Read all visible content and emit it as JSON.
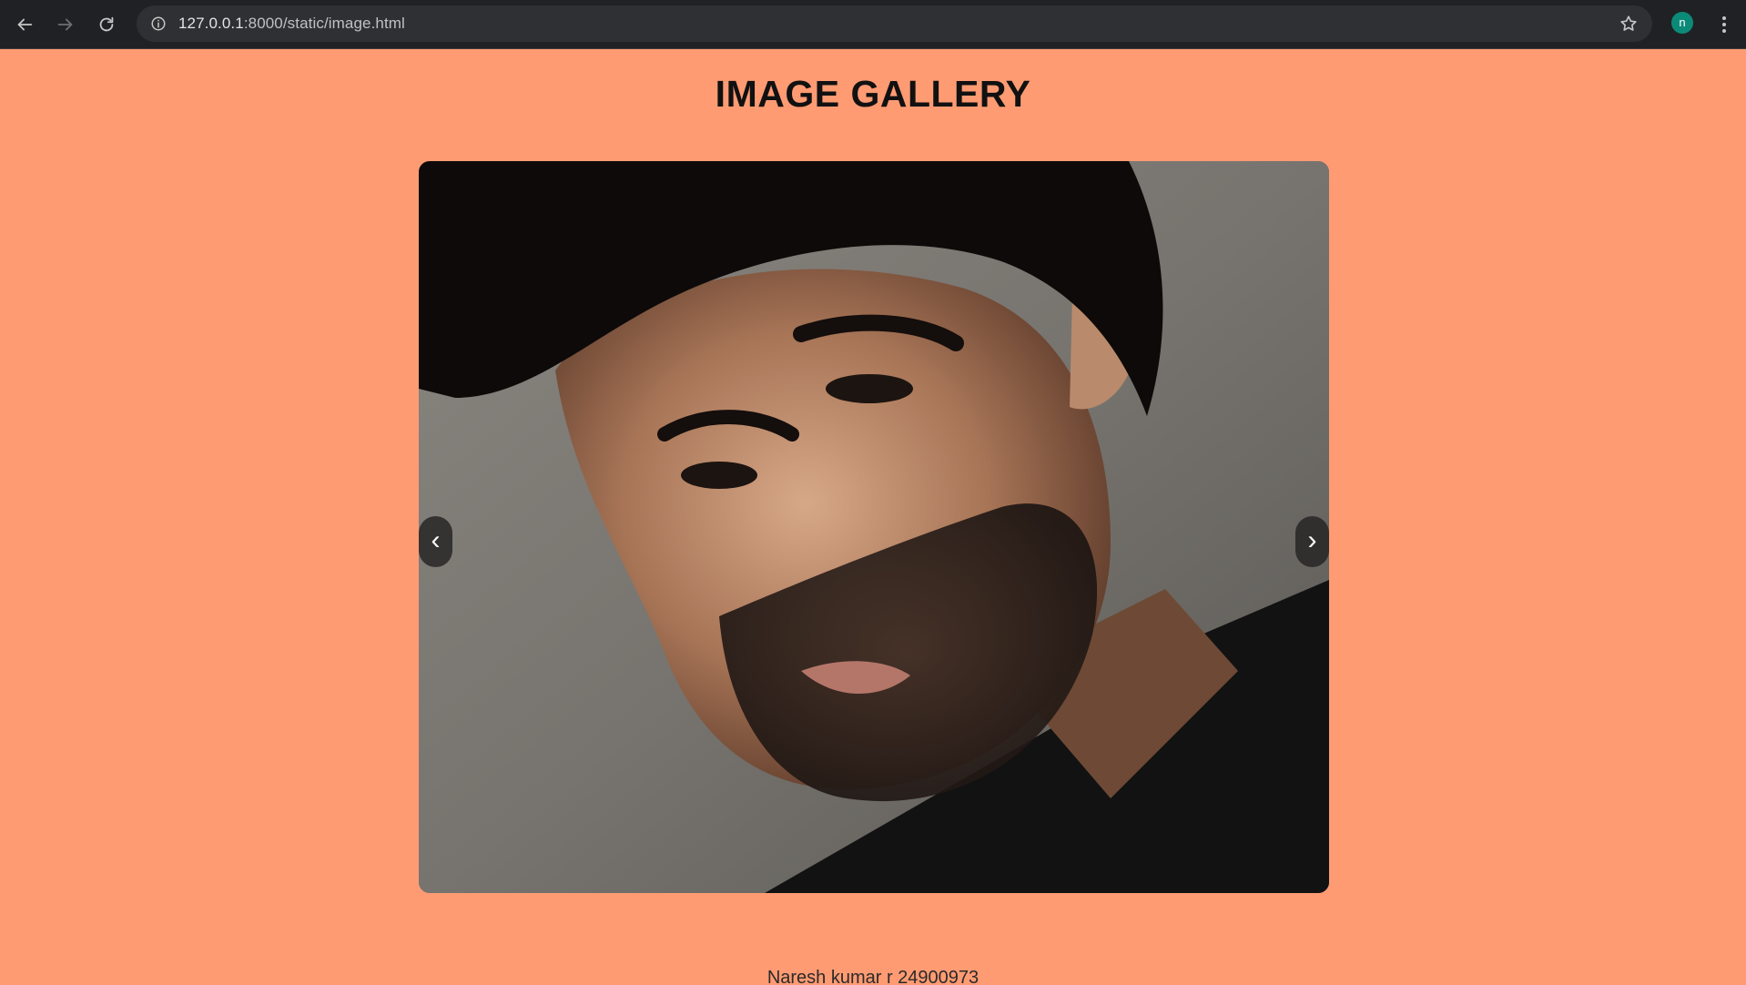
{
  "browser": {
    "url_host": "127.0.0.1",
    "url_path": ":8000/static/image.html",
    "profile_initial": "n",
    "icons": {
      "back": "arrow-left-icon",
      "forward": "arrow-right-icon",
      "reload": "reload-icon",
      "site_info": "info-icon",
      "bookmark": "star-icon",
      "menu": "kebab-menu-icon"
    },
    "colors": {
      "chrome_bg": "#202124",
      "omnibox_bg": "#2f3033",
      "avatar_bg": "#0c8a78"
    }
  },
  "page": {
    "title": "IMAGE GALLERY",
    "background": "#ff9b73",
    "footer": "Naresh kumar r 24900973"
  },
  "gallery": {
    "prev_label": "‹",
    "next_label": "›"
  }
}
